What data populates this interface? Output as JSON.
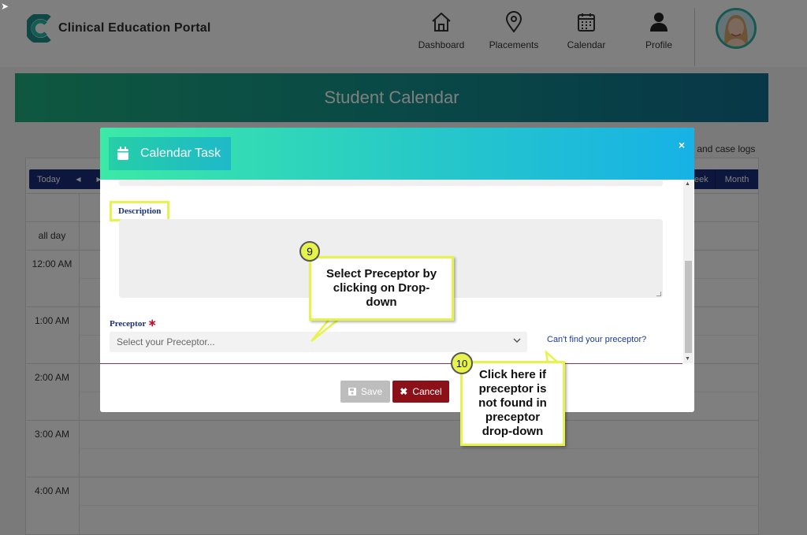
{
  "app": {
    "title": "Clinical Education Portal"
  },
  "nav": [
    {
      "label": "Dashboard",
      "icon": "home-icon"
    },
    {
      "label": "Placements",
      "icon": "map-pin-icon"
    },
    {
      "label": "Calendar",
      "icon": "calendar-icon"
    },
    {
      "label": "Profile",
      "icon": "user-icon"
    }
  ],
  "banner": {
    "title": "Student Calendar"
  },
  "calendar": {
    "toolbar_left": [
      "Today",
      "◀",
      "▶"
    ],
    "toolbar_right": [
      "eek",
      "Month"
    ],
    "case_logs": "s and case logs",
    "all_day": "all day",
    "times": [
      "12:00 AM",
      "1:00 AM",
      "2:00 AM",
      "3:00 AM",
      "4:00 AM"
    ]
  },
  "modal": {
    "title": "Calendar Task",
    "close": "×",
    "description_label": "Description",
    "preceptor_label": "Preceptor",
    "required_mark": "∗",
    "preceptor_placeholder": "Select your Preceptor...",
    "cant_find_link": "Can't find your preceptor?",
    "save_label": "Save",
    "cancel_label": "Cancel"
  },
  "callouts": {
    "step9": {
      "number": "9",
      "text": "Select Preceptor by clicking on Drop-down"
    },
    "step10": {
      "number": "10",
      "text": "Click here if preceptor is not found in preceptor drop-down"
    }
  },
  "colors": {
    "accent_navy": "#1a2f7c",
    "cancel": "#8b1018",
    "highlight": "#e6f34c"
  }
}
